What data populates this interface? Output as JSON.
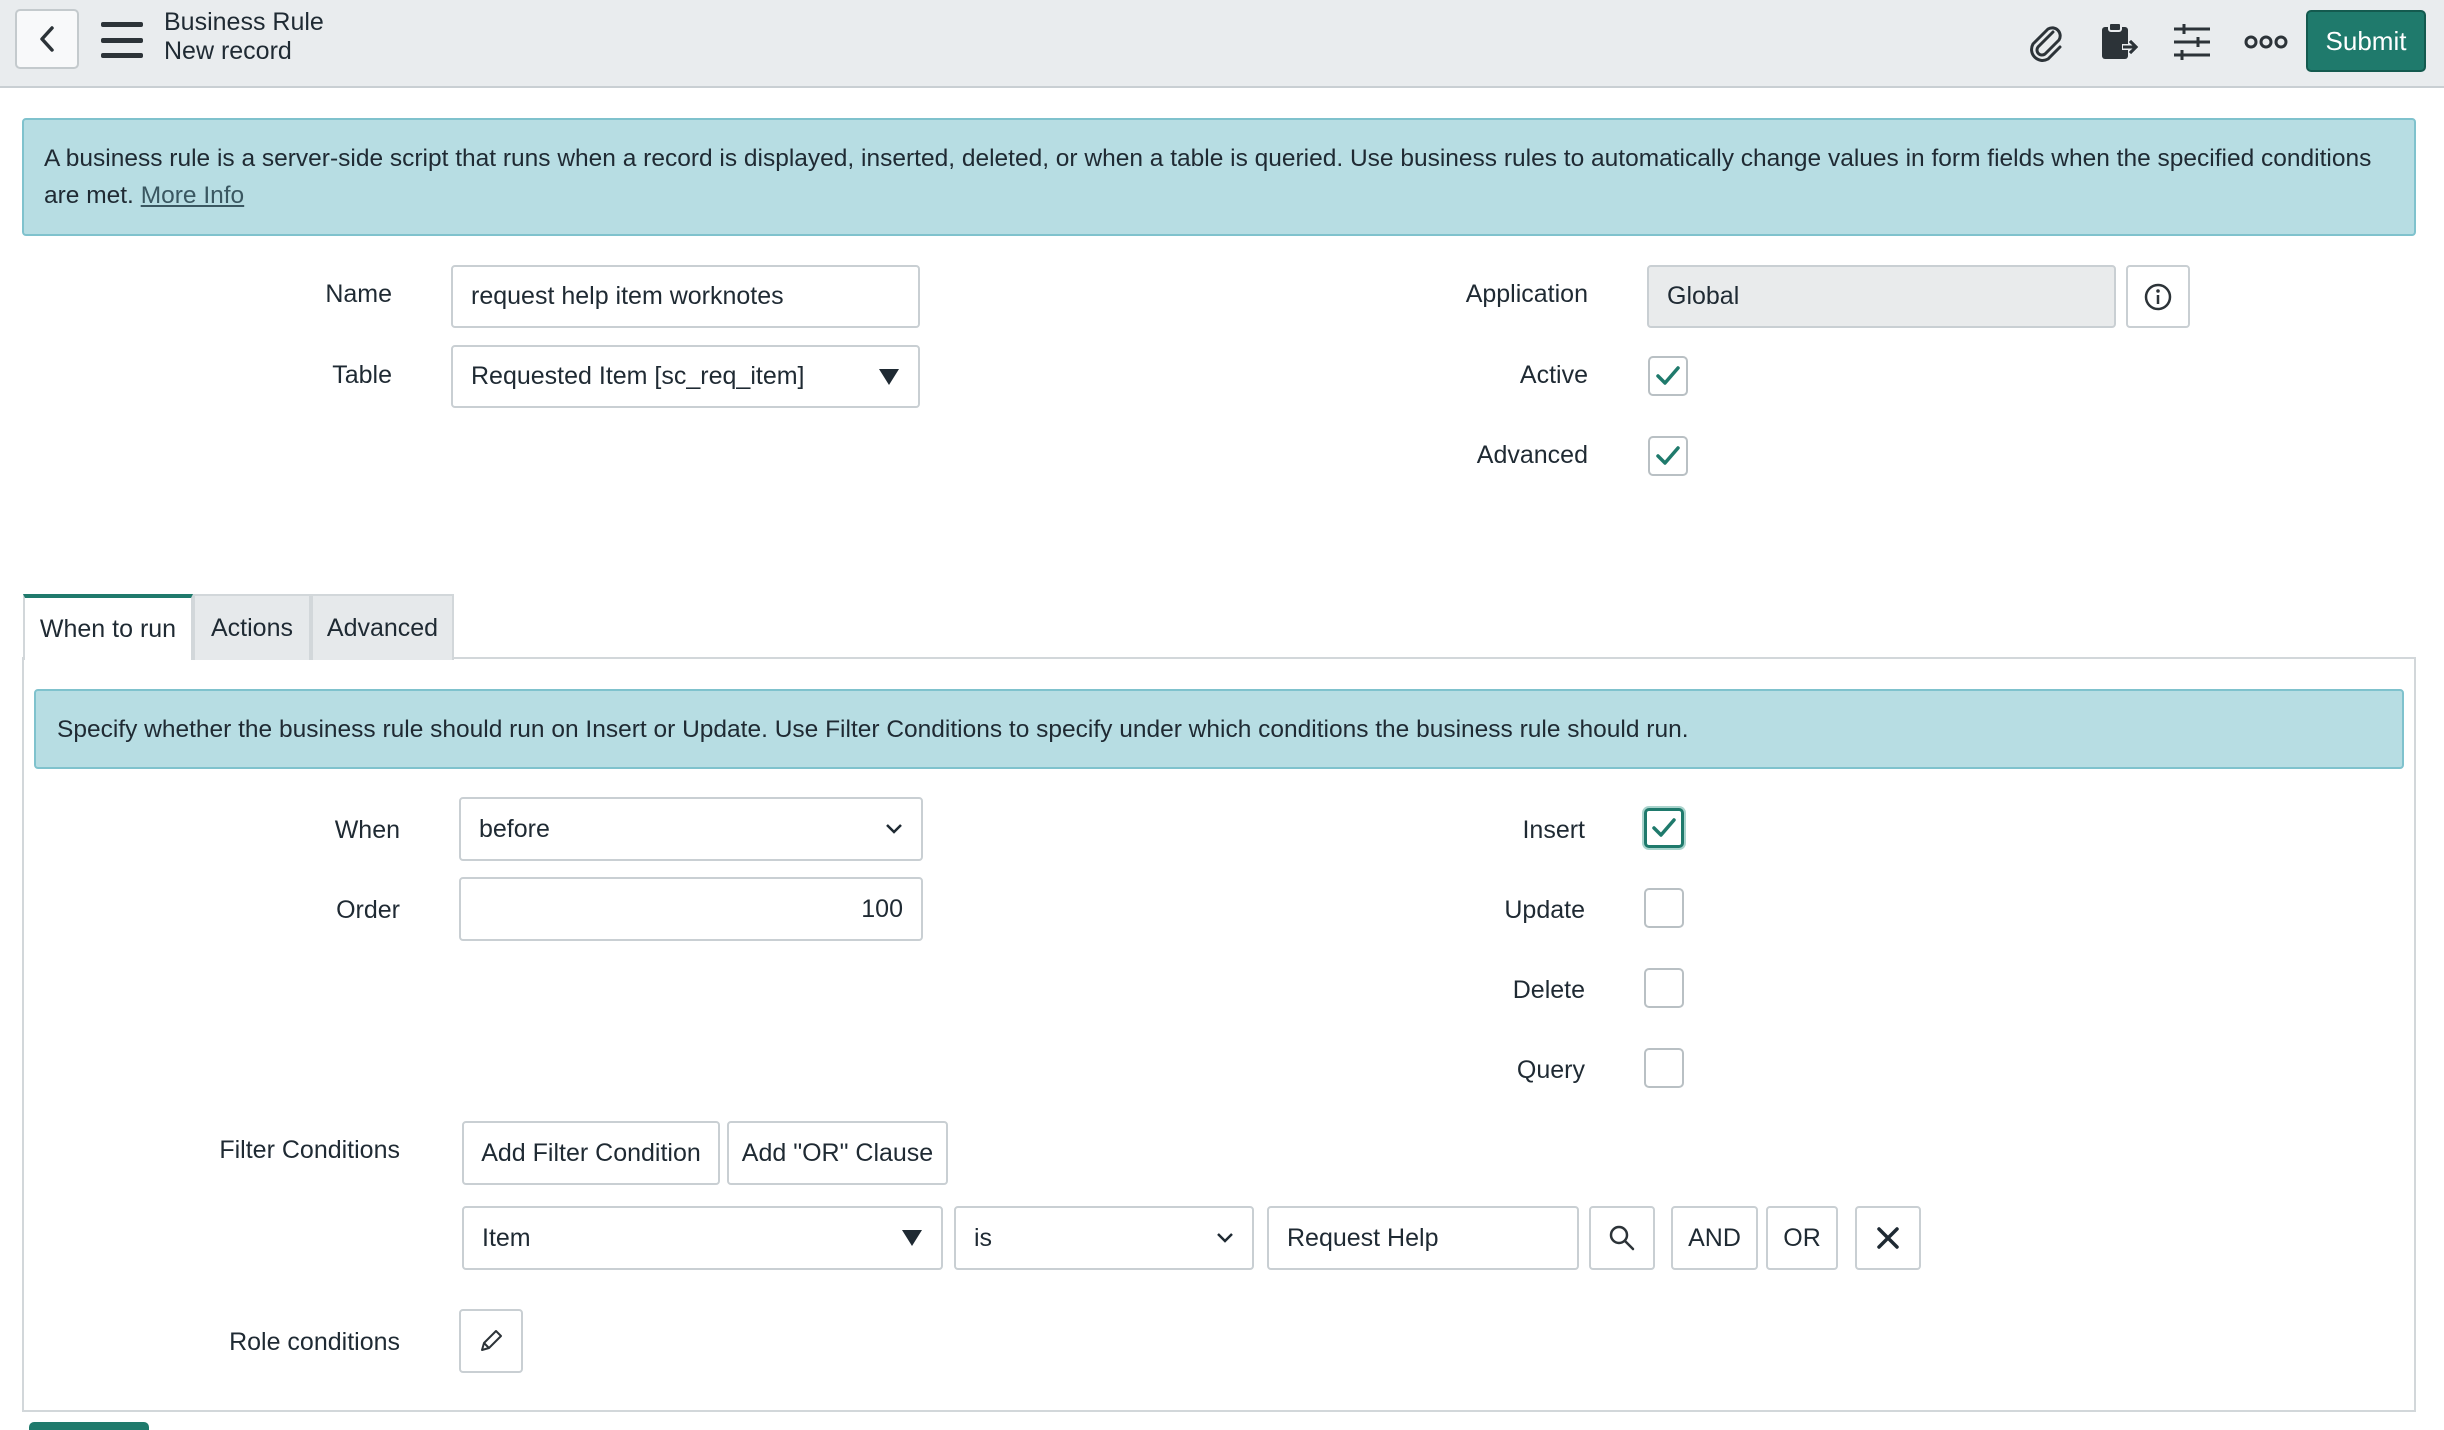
{
  "header": {
    "back_icon": "chevron-left-icon",
    "menu_icon": "hamburger-menu-icon",
    "title": "Business Rule",
    "subtitle": "New record",
    "icons": [
      "paperclip-icon",
      "clipboard-export-icon",
      "sliders-icon",
      "more-icon"
    ],
    "submit_label": "Submit",
    "accent_color": "#1f7a6c"
  },
  "info_banner": {
    "text": "A business rule is a server-side script that runs when a record is displayed, inserted, deleted, or when a table is queried. Use business rules to automatically change values in form fields when the specified conditions are met.",
    "link": "More Info"
  },
  "form": {
    "name_label": "Name",
    "name_value": "request help item worknotes",
    "table_label": "Table",
    "table_value": "Requested Item [sc_req_item]",
    "application_label": "Application",
    "application_value": "Global",
    "active_label": "Active",
    "active_checked": true,
    "advanced_label": "Advanced",
    "advanced_checked": true
  },
  "tabs": [
    {
      "label": "When to run",
      "active": true
    },
    {
      "label": "Actions",
      "active": false
    },
    {
      "label": "Advanced",
      "active": false
    }
  ],
  "when_to_run": {
    "banner": "Specify whether the business rule should run on Insert or Update. Use Filter Conditions to specify under which conditions the business rule should run.",
    "when_label": "When",
    "when_value": "before",
    "order_label": "Order",
    "order_value": "100",
    "insert_label": "Insert",
    "insert_checked": true,
    "update_label": "Update",
    "update_checked": false,
    "delete_label": "Delete",
    "delete_checked": false,
    "query_label": "Query",
    "query_checked": false,
    "filter_label": "Filter Conditions",
    "add_filter_label": "Add Filter Condition",
    "add_or_label": "Add \"OR\" Clause",
    "condition_field": "Item",
    "condition_operator": "is",
    "condition_value": "Request Help",
    "and_label": "AND",
    "or_label": "OR",
    "role_label": "Role conditions"
  }
}
